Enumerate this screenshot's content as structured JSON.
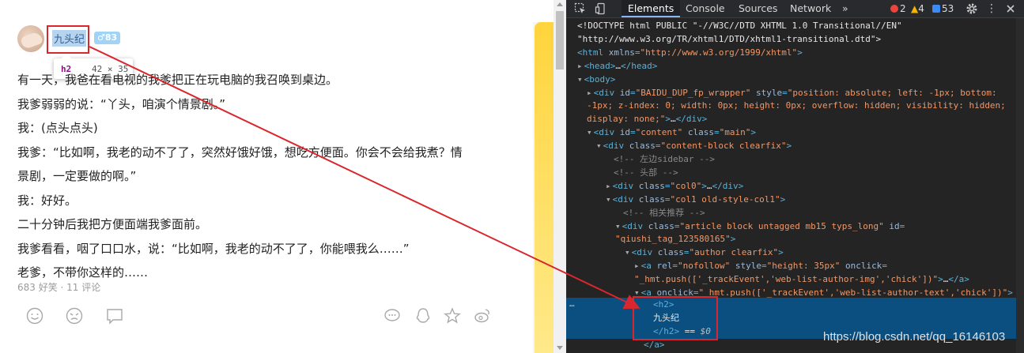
{
  "left": {
    "author_name": "九头纪",
    "age_badge": "♂83",
    "tooltip": {
      "tag": "h2",
      "size": "42 × 35"
    },
    "paragraphs": [
      "有一天，我爸在看电视的我爹把正在玩电脑的我召唤到桌边。",
      "我爹弱弱的说：“丫头，咱演个情景剧。”",
      "我：(点头点头)",
      "我爹：“比如啊，我老的动不了了，突然好饿好饿，想吃方便面。你会不会给我煮？情",
      "景剧，一定要做的啊。”",
      "我：好好。",
      "二十分钟后我把方便面端我爹面前。",
      "我爹看看，咽了口口水，说：“比如啊，我老的动不了了，你能喂我么……”",
      "老爹，不带你这样的……"
    ],
    "stats": "683 好笑 · 11 评论",
    "actions": [
      "smile-icon",
      "sad-icon",
      "comment-icon",
      "chat-icon",
      "qq-icon",
      "star-icon",
      "weibo-icon"
    ]
  },
  "devtools": {
    "tabs": [
      "Elements",
      "Console",
      "Sources",
      "Network",
      "»"
    ],
    "active_tab": "Elements",
    "counts": {
      "errors": "2",
      "warnings": "4",
      "messages": "53"
    },
    "colors": {
      "error": "#e8453c",
      "warning": "#f5b400",
      "message": "#3c8af5",
      "selection": "#0b4f80",
      "annotation": "#d9272d"
    },
    "lines": [
      {
        "segs": [
          [
            "tx",
            "<!DOCTYPE html PUBLIC \"-//W3C//DTD XHTML 1.0 Transitional//EN\""
          ]
        ]
      },
      {
        "segs": [
          [
            "tx",
            "\"http://www.w3.org/TR/xhtml1/DTD/xhtml1-transitional.dtd\">"
          ]
        ]
      },
      {
        "segs": [
          [
            "tg",
            "<html "
          ],
          [
            "at",
            "xmlns"
          ],
          [
            "tg",
            "="
          ],
          [
            "av",
            "\"http://www.w3.org/1999/xhtml\""
          ],
          [
            "tg",
            ">"
          ]
        ]
      },
      {
        "segs": [
          [
            "tri",
            "▸"
          ],
          [
            "tg",
            "<head>"
          ],
          [
            "tx",
            "…"
          ],
          [
            "tg",
            "</head>"
          ]
        ]
      },
      {
        "segs": [
          [
            "tri",
            "▾"
          ],
          [
            "tg",
            "<body>"
          ]
        ]
      },
      {
        "segs": [
          [
            "tri",
            "▸"
          ],
          [
            "tg",
            "<div "
          ],
          [
            "at",
            "id"
          ],
          [
            "tg",
            "="
          ],
          [
            "av",
            "\"BAIDU_DUP_fp_wrapper\""
          ],
          [
            "at",
            " style"
          ],
          [
            "tg",
            "="
          ],
          [
            "av",
            "\"position: absolute; left: -1px; bottom:"
          ]
        ]
      },
      {
        "segs": [
          [
            "av",
            "-1px; z-index: 0; width: 0px; height: 0px; overflow: hidden; visibility: hidden;"
          ]
        ]
      },
      {
        "segs": [
          [
            "av",
            "display: none;\""
          ],
          [
            "tg",
            ">"
          ],
          [
            "tx",
            "…"
          ],
          [
            "tg",
            "</div>"
          ]
        ]
      },
      {
        "segs": [
          [
            "tri",
            "▾"
          ],
          [
            "tg",
            "<div "
          ],
          [
            "at",
            "id"
          ],
          [
            "tg",
            "="
          ],
          [
            "av",
            "\"content\""
          ],
          [
            "at",
            " class"
          ],
          [
            "tg",
            "="
          ],
          [
            "av",
            "\"main\""
          ],
          [
            "tg",
            ">"
          ]
        ]
      },
      {
        "segs": [
          [
            "tri",
            "▾"
          ],
          [
            "tg",
            "<div "
          ],
          [
            "at",
            "class"
          ],
          [
            "tg",
            "="
          ],
          [
            "av",
            "\"content-block clearfix\""
          ],
          [
            "tg",
            ">"
          ]
        ]
      },
      {
        "segs": [
          [
            "cm",
            "<!-- 左边sidebar -->"
          ]
        ]
      },
      {
        "segs": [
          [
            "cm",
            "<!-- 头部 -->"
          ]
        ]
      },
      {
        "segs": [
          [
            "tri",
            "▸"
          ],
          [
            "tg",
            "<div "
          ],
          [
            "at",
            "class"
          ],
          [
            "tg",
            "="
          ],
          [
            "av",
            "\"col0\""
          ],
          [
            "tg",
            ">"
          ],
          [
            "tx",
            "…"
          ],
          [
            "tg",
            "</div>"
          ]
        ]
      },
      {
        "segs": [
          [
            "tri",
            "▾"
          ],
          [
            "tg",
            "<div "
          ],
          [
            "at",
            "class"
          ],
          [
            "tg",
            "="
          ],
          [
            "av",
            "\"col1 old-style-col1\""
          ],
          [
            "tg",
            ">"
          ]
        ]
      },
      {
        "segs": [
          [
            "cm",
            "<!-- 相关推荐 -->"
          ]
        ]
      },
      {
        "segs": [
          [
            "tri",
            "▾"
          ],
          [
            "tg",
            "<div "
          ],
          [
            "at",
            "class"
          ],
          [
            "tg",
            "="
          ],
          [
            "av",
            "\"article block untagged mb15 typs_long\""
          ],
          [
            "at",
            " id"
          ],
          [
            "tg",
            "="
          ]
        ]
      },
      {
        "segs": [
          [
            "av",
            "\"qiushi_tag_123580165\""
          ],
          [
            "tg",
            ">"
          ]
        ]
      },
      {
        "segs": [
          [
            "tri",
            "▾"
          ],
          [
            "tg",
            "<div "
          ],
          [
            "at",
            "class"
          ],
          [
            "tg",
            "="
          ],
          [
            "av",
            "\"author clearfix\""
          ],
          [
            "tg",
            ">"
          ]
        ]
      },
      {
        "segs": [
          [
            "tri",
            "▸"
          ],
          [
            "tg",
            "<a "
          ],
          [
            "at",
            "rel"
          ],
          [
            "tg",
            "="
          ],
          [
            "av",
            "\"nofollow\""
          ],
          [
            "at",
            " style"
          ],
          [
            "tg",
            "="
          ],
          [
            "av",
            "\"height: 35px\""
          ],
          [
            "at",
            " onclick"
          ],
          [
            "tg",
            "="
          ]
        ]
      },
      {
        "segs": [
          [
            "av",
            "\"_hmt.push(['_trackEvent','web-list-author-img','chick'])\""
          ],
          [
            "tg",
            ">"
          ],
          [
            "tx",
            "…"
          ],
          [
            "tg",
            "</a>"
          ]
        ]
      },
      {
        "segs": [
          [
            "tri",
            "▾"
          ],
          [
            "tg",
            "<a "
          ],
          [
            "at",
            "onclick"
          ],
          [
            "tg",
            "="
          ],
          [
            "av",
            "\"_hmt.push(['_trackEvent','web-list-author-text','chick'])\""
          ],
          [
            "tg",
            ">"
          ]
        ]
      },
      {
        "segs": [
          [
            "tg",
            "<h2>"
          ]
        ]
      },
      {
        "segs": [
          [
            "tx",
            "九头纪"
          ]
        ]
      },
      {
        "segs": [
          [
            "tg",
            "</h2>"
          ],
          [
            "tx",
            " == "
          ],
          [
            "tx",
            "$0"
          ]
        ]
      },
      {
        "segs": [
          [
            "tg",
            "</a>"
          ]
        ]
      }
    ],
    "sel_dots": "…",
    "watermark": "https://blog.csdn.net/qq_16146103"
  }
}
